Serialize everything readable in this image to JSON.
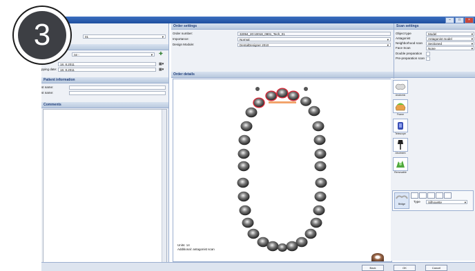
{
  "step_number": "3",
  "left": {
    "field1_value": "01",
    "field2_value": "ne -",
    "date1_label": "",
    "date1_value": "18. 8.2011",
    "date2_label": "pping date:",
    "date2_value": "18. 8.2011",
    "patient_header": "Patient information",
    "first_name_label": "st name:",
    "last_name_label": "st name:",
    "comments_header": "Comments"
  },
  "order_settings": {
    "header": "Order settings",
    "order_number_label": "Order number:",
    "order_number_value": "32094_20:10018_0901_Tech_01",
    "importance_label": "Importance:",
    "importance_value": "Normal",
    "design_module_label": "Design Module:",
    "design_module_value": "DentalDesigner 2010"
  },
  "scan_settings": {
    "header": "Scan settings",
    "rows": [
      {
        "label": "Object type",
        "value": "Model"
      },
      {
        "label": "Antagonist",
        "value": "Antagonist model"
      },
      {
        "label": "Neighborhood scan",
        "value": "Sectioned"
      },
      {
        "label": "Face Scan",
        "value": "None"
      }
    ],
    "double_prep_label": "Double preparation",
    "pre_prep_label": "Pre-preparation scan"
  },
  "order_details": {
    "header": "Order details",
    "info_line1": "Units: 14",
    "info_line2": "Additional: antagonist scan"
  },
  "tools": [
    {
      "name": "anatomic",
      "label": "Anatomic"
    },
    {
      "name": "frame",
      "label": "Frame"
    },
    {
      "name": "telescope",
      "label": "Telescope"
    },
    {
      "name": "abutment",
      "label": "Abutment"
    },
    {
      "name": "removable",
      "label": "Removable"
    }
  ],
  "bridge": {
    "label": "Bridge",
    "type_label": "Type",
    "type_value": "Silhouette"
  },
  "buttons": {
    "back": "Back",
    "ok": "OK",
    "cancel": "Cancel"
  },
  "colors": {
    "titlebar": "#2a5db0",
    "selected_tooth": "#d62b3a",
    "pontic": "#f2a46b"
  }
}
